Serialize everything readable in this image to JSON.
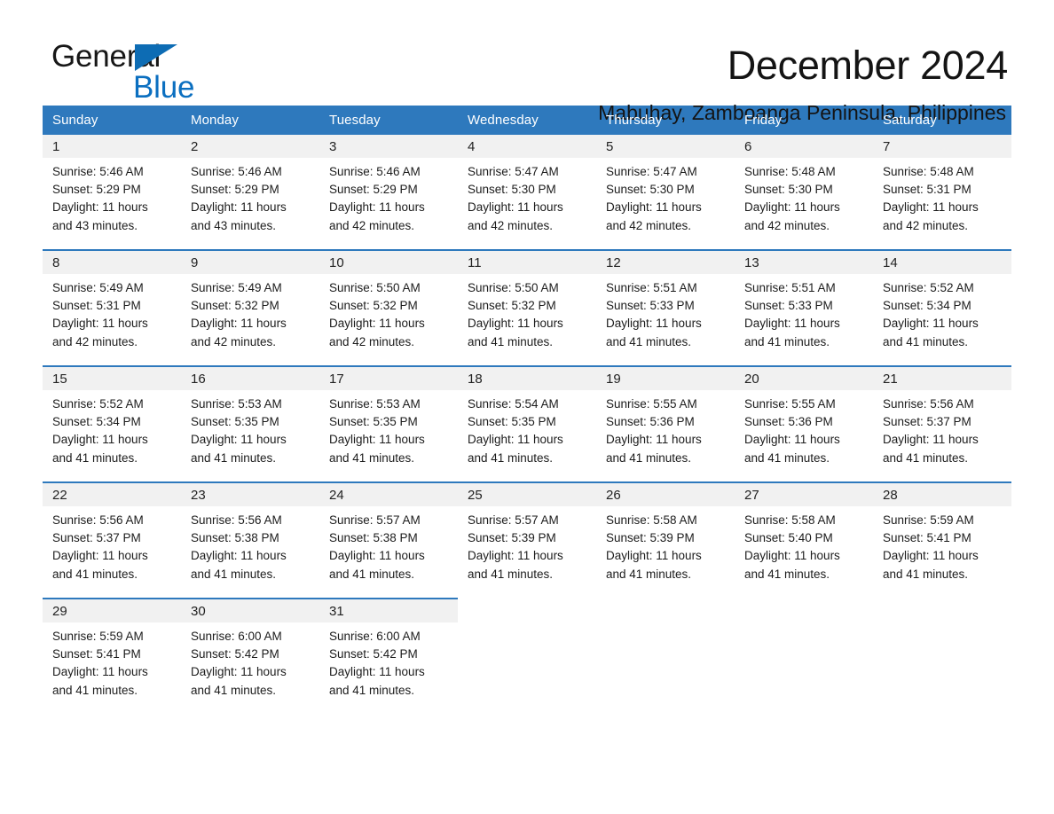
{
  "logo": {
    "word_one": "General",
    "word_two": "Blue",
    "triangle": "triangle-logo-mark",
    "brand_black": "#171717",
    "brand_blue": "#0b6fc0"
  },
  "header": {
    "month_title": "December 2024",
    "location": "Mabuhay, Zamboanga Peninsula, Philippines"
  },
  "theme": {
    "header_blue": "#2e79bd",
    "daynum_bg": "#f1f1f1",
    "text": "#1c1c1c"
  },
  "weekdays": [
    "Sunday",
    "Monday",
    "Tuesday",
    "Wednesday",
    "Thursday",
    "Friday",
    "Saturday"
  ],
  "weeks": [
    {
      "days": [
        {
          "num": "1",
          "sunrise": "Sunrise: 5:46 AM",
          "sunset": "Sunset: 5:29 PM",
          "daylight_1": "Daylight: 11 hours",
          "daylight_2": "and 43 minutes."
        },
        {
          "num": "2",
          "sunrise": "Sunrise: 5:46 AM",
          "sunset": "Sunset: 5:29 PM",
          "daylight_1": "Daylight: 11 hours",
          "daylight_2": "and 43 minutes."
        },
        {
          "num": "3",
          "sunrise": "Sunrise: 5:46 AM",
          "sunset": "Sunset: 5:29 PM",
          "daylight_1": "Daylight: 11 hours",
          "daylight_2": "and 42 minutes."
        },
        {
          "num": "4",
          "sunrise": "Sunrise: 5:47 AM",
          "sunset": "Sunset: 5:30 PM",
          "daylight_1": "Daylight: 11 hours",
          "daylight_2": "and 42 minutes."
        },
        {
          "num": "5",
          "sunrise": "Sunrise: 5:47 AM",
          "sunset": "Sunset: 5:30 PM",
          "daylight_1": "Daylight: 11 hours",
          "daylight_2": "and 42 minutes."
        },
        {
          "num": "6",
          "sunrise": "Sunrise: 5:48 AM",
          "sunset": "Sunset: 5:30 PM",
          "daylight_1": "Daylight: 11 hours",
          "daylight_2": "and 42 minutes."
        },
        {
          "num": "7",
          "sunrise": "Sunrise: 5:48 AM",
          "sunset": "Sunset: 5:31 PM",
          "daylight_1": "Daylight: 11 hours",
          "daylight_2": "and 42 minutes."
        }
      ]
    },
    {
      "days": [
        {
          "num": "8",
          "sunrise": "Sunrise: 5:49 AM",
          "sunset": "Sunset: 5:31 PM",
          "daylight_1": "Daylight: 11 hours",
          "daylight_2": "and 42 minutes."
        },
        {
          "num": "9",
          "sunrise": "Sunrise: 5:49 AM",
          "sunset": "Sunset: 5:32 PM",
          "daylight_1": "Daylight: 11 hours",
          "daylight_2": "and 42 minutes."
        },
        {
          "num": "10",
          "sunrise": "Sunrise: 5:50 AM",
          "sunset": "Sunset: 5:32 PM",
          "daylight_1": "Daylight: 11 hours",
          "daylight_2": "and 42 minutes."
        },
        {
          "num": "11",
          "sunrise": "Sunrise: 5:50 AM",
          "sunset": "Sunset: 5:32 PM",
          "daylight_1": "Daylight: 11 hours",
          "daylight_2": "and 41 minutes."
        },
        {
          "num": "12",
          "sunrise": "Sunrise: 5:51 AM",
          "sunset": "Sunset: 5:33 PM",
          "daylight_1": "Daylight: 11 hours",
          "daylight_2": "and 41 minutes."
        },
        {
          "num": "13",
          "sunrise": "Sunrise: 5:51 AM",
          "sunset": "Sunset: 5:33 PM",
          "daylight_1": "Daylight: 11 hours",
          "daylight_2": "and 41 minutes."
        },
        {
          "num": "14",
          "sunrise": "Sunrise: 5:52 AM",
          "sunset": "Sunset: 5:34 PM",
          "daylight_1": "Daylight: 11 hours",
          "daylight_2": "and 41 minutes."
        }
      ]
    },
    {
      "days": [
        {
          "num": "15",
          "sunrise": "Sunrise: 5:52 AM",
          "sunset": "Sunset: 5:34 PM",
          "daylight_1": "Daylight: 11 hours",
          "daylight_2": "and 41 minutes."
        },
        {
          "num": "16",
          "sunrise": "Sunrise: 5:53 AM",
          "sunset": "Sunset: 5:35 PM",
          "daylight_1": "Daylight: 11 hours",
          "daylight_2": "and 41 minutes."
        },
        {
          "num": "17",
          "sunrise": "Sunrise: 5:53 AM",
          "sunset": "Sunset: 5:35 PM",
          "daylight_1": "Daylight: 11 hours",
          "daylight_2": "and 41 minutes."
        },
        {
          "num": "18",
          "sunrise": "Sunrise: 5:54 AM",
          "sunset": "Sunset: 5:35 PM",
          "daylight_1": "Daylight: 11 hours",
          "daylight_2": "and 41 minutes."
        },
        {
          "num": "19",
          "sunrise": "Sunrise: 5:55 AM",
          "sunset": "Sunset: 5:36 PM",
          "daylight_1": "Daylight: 11 hours",
          "daylight_2": "and 41 minutes."
        },
        {
          "num": "20",
          "sunrise": "Sunrise: 5:55 AM",
          "sunset": "Sunset: 5:36 PM",
          "daylight_1": "Daylight: 11 hours",
          "daylight_2": "and 41 minutes."
        },
        {
          "num": "21",
          "sunrise": "Sunrise: 5:56 AM",
          "sunset": "Sunset: 5:37 PM",
          "daylight_1": "Daylight: 11 hours",
          "daylight_2": "and 41 minutes."
        }
      ]
    },
    {
      "days": [
        {
          "num": "22",
          "sunrise": "Sunrise: 5:56 AM",
          "sunset": "Sunset: 5:37 PM",
          "daylight_1": "Daylight: 11 hours",
          "daylight_2": "and 41 minutes."
        },
        {
          "num": "23",
          "sunrise": "Sunrise: 5:56 AM",
          "sunset": "Sunset: 5:38 PM",
          "daylight_1": "Daylight: 11 hours",
          "daylight_2": "and 41 minutes."
        },
        {
          "num": "24",
          "sunrise": "Sunrise: 5:57 AM",
          "sunset": "Sunset: 5:38 PM",
          "daylight_1": "Daylight: 11 hours",
          "daylight_2": "and 41 minutes."
        },
        {
          "num": "25",
          "sunrise": "Sunrise: 5:57 AM",
          "sunset": "Sunset: 5:39 PM",
          "daylight_1": "Daylight: 11 hours",
          "daylight_2": "and 41 minutes."
        },
        {
          "num": "26",
          "sunrise": "Sunrise: 5:58 AM",
          "sunset": "Sunset: 5:39 PM",
          "daylight_1": "Daylight: 11 hours",
          "daylight_2": "and 41 minutes."
        },
        {
          "num": "27",
          "sunrise": "Sunrise: 5:58 AM",
          "sunset": "Sunset: 5:40 PM",
          "daylight_1": "Daylight: 11 hours",
          "daylight_2": "and 41 minutes."
        },
        {
          "num": "28",
          "sunrise": "Sunrise: 5:59 AM",
          "sunset": "Sunset: 5:41 PM",
          "daylight_1": "Daylight: 11 hours",
          "daylight_2": "and 41 minutes."
        }
      ]
    },
    {
      "days": [
        {
          "num": "29",
          "sunrise": "Sunrise: 5:59 AM",
          "sunset": "Sunset: 5:41 PM",
          "daylight_1": "Daylight: 11 hours",
          "daylight_2": "and 41 minutes."
        },
        {
          "num": "30",
          "sunrise": "Sunrise: 6:00 AM",
          "sunset": "Sunset: 5:42 PM",
          "daylight_1": "Daylight: 11 hours",
          "daylight_2": "and 41 minutes."
        },
        {
          "num": "31",
          "sunrise": "Sunrise: 6:00 AM",
          "sunset": "Sunset: 5:42 PM",
          "daylight_1": "Daylight: 11 hours",
          "daylight_2": "and 41 minutes."
        },
        {
          "num": "",
          "sunrise": "",
          "sunset": "",
          "daylight_1": "",
          "daylight_2": ""
        },
        {
          "num": "",
          "sunrise": "",
          "sunset": "",
          "daylight_1": "",
          "daylight_2": ""
        },
        {
          "num": "",
          "sunrise": "",
          "sunset": "",
          "daylight_1": "",
          "daylight_2": ""
        },
        {
          "num": "",
          "sunrise": "",
          "sunset": "",
          "daylight_1": "",
          "daylight_2": ""
        }
      ]
    }
  ]
}
